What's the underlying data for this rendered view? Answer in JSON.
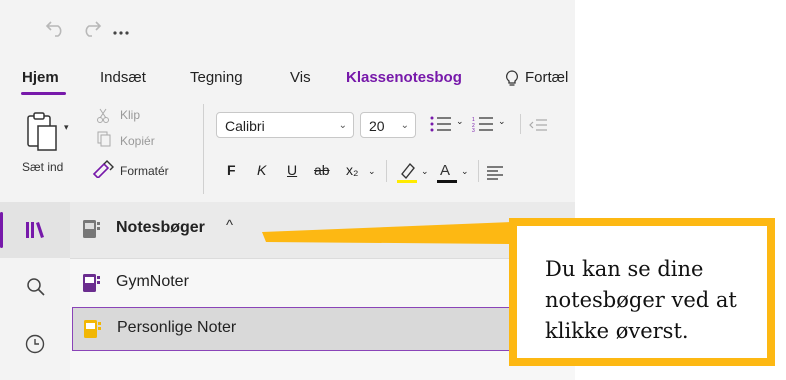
{
  "tabs": [
    {
      "label": "Hjem"
    },
    {
      "label": "Indsæt"
    },
    {
      "label": "Tegning"
    },
    {
      "label": "Vis"
    },
    {
      "label": "Klassenotesbog"
    },
    {
      "label": "Fortæl"
    }
  ],
  "ribbon": {
    "paste_label": "Sæt ind",
    "cut_label": "Klip",
    "copy_label": "Kopiér",
    "format_painter_label": "Formatér",
    "font_name": "Calibri",
    "font_size": "20",
    "bold": "F",
    "italic": "K",
    "underline": "U",
    "strikethrough": "ab",
    "subscript": "x₂"
  },
  "notebooks": {
    "header": "Notesbøger",
    "items": [
      {
        "label": "GymNoter",
        "color": "#6b2d8f"
      },
      {
        "label": "Personlige Noter",
        "color": "#f2b705"
      }
    ]
  },
  "callout": {
    "text": "Du kan se dine notesbøger ved at klikke øverst."
  },
  "colors": {
    "accent": "#7719aa",
    "highlight": "#fdb813"
  },
  "icons": [
    "undo-icon",
    "redo-icon",
    "more-icon",
    "lightbulb-icon",
    "library-icon",
    "search-icon",
    "clock-icon"
  ]
}
